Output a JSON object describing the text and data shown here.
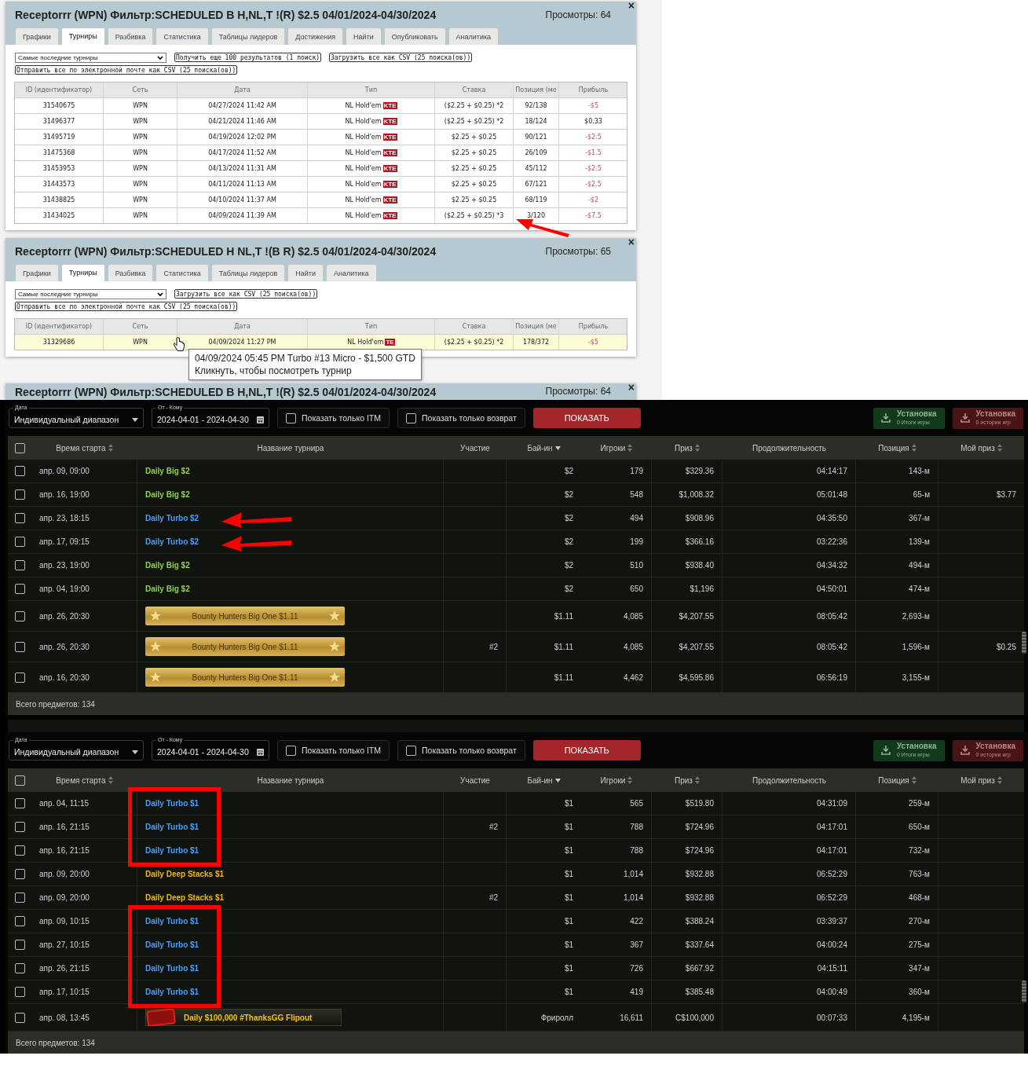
{
  "light_panels": [
    {
      "title": "Receptorrr (WPN) Фильтр:SCHEDULED B H,NL,T !(R) $2.5 04/01/2024-04/30/2024",
      "views": "Просмотры: 64",
      "close": "×",
      "tabs": [
        {
          "label": "Графики",
          "selected": false
        },
        {
          "label": "Турниры",
          "selected": true
        },
        {
          "label": "Разбивка",
          "selected": false
        },
        {
          "label": "Статистика",
          "selected": false
        },
        {
          "label": "Таблицы лидеров",
          "selected": false
        },
        {
          "label": "Достижения",
          "selected": false
        },
        {
          "label": "Найти",
          "selected": false
        },
        {
          "label": "Опубликовать",
          "selected": false
        },
        {
          "label": "Аналитика",
          "selected": false
        }
      ],
      "select": "Самые последние турниры",
      "actions": [
        "Получить еще 100 результатов (1 поиск)",
        "Загрузить все как CSV (25 поиска(ов))",
        "Отправить все по электронной почте как CSV (25 поиска(ов))"
      ],
      "columns": [
        "ID (идентификатор)",
        "Сеть",
        "Дата",
        "Тип",
        "Ставка",
        "Позиция (ме",
        "Прибыль"
      ],
      "rows": [
        {
          "id": "31540675",
          "network": "WPN",
          "date": "04/27/2024 11:42 AM",
          "type": "NL Hold'em",
          "badge": "KTE",
          "stake": "($2.25 + $0.25) *2",
          "position": "92/138",
          "profit": "-$5",
          "loss": true,
          "highlighted": false,
          "marked": false
        },
        {
          "id": "31496377",
          "network": "WPN",
          "date": "04/21/2024 11:46 AM",
          "type": "NL Hold'em",
          "badge": "KTE",
          "stake": "($2.25 + $0.25) *2",
          "position": "18/124",
          "profit": "$0.33",
          "loss": false,
          "highlighted": false,
          "marked": false
        },
        {
          "id": "31495719",
          "network": "WPN",
          "date": "04/19/2024 12:02 PM",
          "type": "NL Hold'em",
          "badge": "KTE",
          "stake": "$2.25 + $0.25",
          "position": "90/121",
          "profit": "-$2.5",
          "loss": true,
          "highlighted": false,
          "marked": false
        },
        {
          "id": "31475368",
          "network": "WPN",
          "date": "04/17/2024 11:52 AM",
          "type": "NL Hold'em",
          "badge": "KTE",
          "stake": "$2.25 + $0.25",
          "position": "26/109",
          "profit": "-$1.5",
          "loss": true,
          "highlighted": false,
          "marked": false
        },
        {
          "id": "31453953",
          "network": "WPN",
          "date": "04/13/2024 11:31 AM",
          "type": "NL Hold'em",
          "badge": "KTE",
          "stake": "$2.25 + $0.25",
          "position": "45/112",
          "profit": "-$2.5",
          "loss": true,
          "highlighted": false,
          "marked": false
        },
        {
          "id": "31443573",
          "network": "WPN",
          "date": "04/11/2024 11:13 AM",
          "type": "NL Hold'em",
          "badge": "KTE",
          "stake": "$2.25 + $0.25",
          "position": "67/121",
          "profit": "-$2.5",
          "loss": true,
          "highlighted": false,
          "marked": false
        },
        {
          "id": "31438825",
          "network": "WPN",
          "date": "04/10/2024 11:37 AM",
          "type": "NL Hold'em",
          "badge": "KTE",
          "stake": "$2.25 + $0.25",
          "position": "68/119",
          "profit": "-$2",
          "loss": true,
          "highlighted": false,
          "marked": false
        },
        {
          "id": "31434025",
          "network": "WPN",
          "date": "04/09/2024 11:39 AM",
          "type": "NL Hold'em",
          "badge": "KTE",
          "stake": "($2.25 + $0.25) *3",
          "position": "3/120",
          "profit": "-$7.5",
          "loss": true,
          "highlighted": false,
          "marked": true
        }
      ]
    },
    {
      "title": "Receptorrr (WPN) Фильтр:SCHEDULED H NL,T !(B R) $2.5 04/01/2024-04/30/2024",
      "views": "Просмотры: 65",
      "close": "×",
      "tabs": [
        {
          "label": "Графики",
          "selected": false
        },
        {
          "label": "Турниры",
          "selected": true
        },
        {
          "label": "Разбивка",
          "selected": false
        },
        {
          "label": "Статистика",
          "selected": false
        },
        {
          "label": "Таблицы лидеров",
          "selected": false
        },
        {
          "label": "Найти",
          "selected": false
        },
        {
          "label": "Аналитика",
          "selected": false
        }
      ],
      "select": "Самые последние турниры",
      "actions": [
        "Загрузить все как CSV (25 поиска(ов))",
        "Отправить все по электронной почте как CSV (25 поиска(ов))"
      ],
      "columns": [
        "ID (идентификатор)",
        "Сеть",
        "Дата",
        "Тип",
        "Ставка",
        "Позиция (ме",
        "Прибыль"
      ],
      "rows": [
        {
          "id": "31329686",
          "network": "WPN",
          "date": "04/09/2024 11:27 PM",
          "type": "NL Hold'em",
          "badge": "TE",
          "stake": "($2.25 + $0.25) *2",
          "position": "178/372",
          "profit": "-$5",
          "loss": true,
          "highlighted": true,
          "marked": false
        }
      ],
      "tooltip": [
        "04/09/2024 05:45 PM Turbo #13 Micro - $1,500 GTD",
        "Кликнуть, чтобы посмотреть турнир"
      ]
    }
  ],
  "partial_panel": {
    "title": "Receptorrr (WPN) Фильтр:SCHEDULED B H,NL,T !(R) $2.5 04/01/2024-04/30/2024",
    "views": "Просмотры: 64",
    "close": "×"
  },
  "dark_panels": [
    {
      "filters": {
        "date_label": "Дата",
        "date_value": "Индивидуальный диапазон",
        "range_label": "От - Кому",
        "range_value": "2024-04-01 - 2024-04-30",
        "checks": [
          {
            "label": "Показать только ITM",
            "checked": false
          },
          {
            "label": "Показать только возврат",
            "checked": false
          }
        ],
        "show": "ПОКАЗАТЬ",
        "exports": [
          {
            "title": "Установка",
            "sub": "0 Итоги игры",
            "kind": "green"
          },
          {
            "title": "Установка",
            "sub": "0 истории игр",
            "kind": "red"
          }
        ]
      },
      "header_checked": false,
      "columns": [
        {
          "label": "Время старта",
          "sortable": true,
          "sorted": false
        },
        {
          "label": "Название турнира",
          "sortable": false,
          "sorted": false
        },
        {
          "label": "Участие",
          "sortable": false,
          "sorted": false
        },
        {
          "label": "Бай-ин",
          "sortable": true,
          "sorted": true
        },
        {
          "label": "Игроки",
          "sortable": true,
          "sorted": false
        },
        {
          "label": "Приз",
          "sortable": true,
          "sorted": false
        },
        {
          "label": "Продолжительность",
          "sortable": false,
          "sorted": false
        },
        {
          "label": "Позиция",
          "sortable": true,
          "sorted": false
        },
        {
          "label": "Мой приз",
          "sortable": true,
          "sorted": false
        }
      ],
      "rows": [
        {
          "checked": false,
          "time": "апр. 09, 09:00",
          "name": "Daily Big $2",
          "kind": "text",
          "color": "#8fd14f",
          "entry": "",
          "buyin": "$2",
          "players": "179",
          "prize": "$329.36",
          "duration": "04:14:17",
          "position": "143-м",
          "my_prize": "",
          "marked": false,
          "framed": false
        },
        {
          "checked": false,
          "time": "апр. 16, 19:00",
          "name": "Daily Big $2",
          "kind": "text",
          "color": "#8fd14f",
          "entry": "",
          "buyin": "$2",
          "players": "548",
          "prize": "$1,008.32",
          "duration": "05:01:48",
          "position": "65-м",
          "my_prize": "$3.77",
          "marked": false,
          "framed": false
        },
        {
          "checked": false,
          "time": "апр. 23, 18:15",
          "name": "Daily Turbo $2",
          "kind": "text",
          "color": "#4f9cf2",
          "entry": "",
          "buyin": "$2",
          "players": "494",
          "prize": "$908.96",
          "duration": "04:35:50",
          "position": "367-м",
          "my_prize": "",
          "marked": true,
          "framed": false
        },
        {
          "checked": false,
          "time": "апр. 17, 09:15",
          "name": "Daily Turbo $2",
          "kind": "text",
          "color": "#4f9cf2",
          "entry": "",
          "buyin": "$2",
          "players": "199",
          "prize": "$366.16",
          "duration": "03:22:36",
          "position": "139-м",
          "my_prize": "",
          "marked": true,
          "framed": false
        },
        {
          "checked": false,
          "time": "апр. 23, 19:00",
          "name": "Daily Big $2",
          "kind": "text",
          "color": "#8fd14f",
          "entry": "",
          "buyin": "$2",
          "players": "510",
          "prize": "$938.40",
          "duration": "04:34:32",
          "position": "494-м",
          "my_prize": "",
          "marked": false,
          "framed": false
        },
        {
          "checked": false,
          "time": "апр. 04, 19:00",
          "name": "Daily Big $2",
          "kind": "text",
          "color": "#8fd14f",
          "entry": "",
          "buyin": "$2",
          "players": "650",
          "prize": "$1,196",
          "duration": "04:50:01",
          "position": "474-м",
          "my_prize": "",
          "marked": false,
          "framed": false
        },
        {
          "checked": false,
          "time": "апр. 26, 20:30",
          "name": "Bounty Hunters Big One $1.11",
          "kind": "banner",
          "entry": "",
          "buyin": "$1.11",
          "players": "4,085",
          "prize": "$4,207.55",
          "duration": "08:05:42",
          "position": "2,693-м",
          "my_prize": "",
          "marked": false,
          "framed": false
        },
        {
          "checked": false,
          "time": "апр. 26, 20:30",
          "name": "Bounty Hunters Big One $1.11",
          "kind": "banner",
          "entry": "#2",
          "buyin": "$1.11",
          "players": "4,085",
          "prize": "$4,207.55",
          "duration": "08:05:42",
          "position": "1,596-м",
          "my_prize": "$0.25",
          "marked": false,
          "framed": false
        },
        {
          "checked": false,
          "time": "апр. 16, 20:30",
          "name": "Bounty Hunters Big One $1.11",
          "kind": "banner",
          "entry": "",
          "buyin": "$1.11",
          "players": "4,462",
          "prize": "$4,595.86",
          "duration": "06:56:19",
          "position": "3,155-м",
          "my_prize": "",
          "marked": false,
          "framed": false
        }
      ],
      "footer": "Всего предметов: 134"
    },
    {
      "filters": {
        "date_label": "Дата",
        "date_value": "Индивидуальный диапазон",
        "range_label": "От - Кому",
        "range_value": "2024-04-01 - 2024-04-30",
        "checks": [
          {
            "label": "Показать только ITM",
            "checked": false
          },
          {
            "label": "Показать только возврат",
            "checked": false
          }
        ],
        "show": "ПОКАЗАТЬ",
        "exports": [
          {
            "title": "Установка",
            "sub": "0 Итоги игры",
            "kind": "green"
          },
          {
            "title": "Установка",
            "sub": "0 истории игр",
            "kind": "red"
          }
        ]
      },
      "header_checked": false,
      "columns": [
        {
          "label": "Время старта",
          "sortable": true,
          "sorted": false
        },
        {
          "label": "Название турнира",
          "sortable": false,
          "sorted": false
        },
        {
          "label": "Участие",
          "sortable": false,
          "sorted": false
        },
        {
          "label": "Бай-ин",
          "sortable": true,
          "sorted": true
        },
        {
          "label": "Игроки",
          "sortable": true,
          "sorted": false
        },
        {
          "label": "Приз",
          "sortable": true,
          "sorted": false
        },
        {
          "label": "Продолжительность",
          "sortable": false,
          "sorted": false
        },
        {
          "label": "Позиция",
          "sortable": true,
          "sorted": false
        },
        {
          "label": "Мой приз",
          "sortable": true,
          "sorted": false
        }
      ],
      "rows": [
        {
          "checked": false,
          "time": "апр. 04, 11:15",
          "name": "Daily Turbo $1",
          "kind": "text",
          "color": "#4f9cf2",
          "entry": "",
          "buyin": "$1",
          "players": "565",
          "prize": "$519.80",
          "duration": "04:31:09",
          "position": "259-м",
          "my_prize": "",
          "marked": false,
          "framed": true
        },
        {
          "checked": false,
          "time": "апр. 16, 21:15",
          "name": "Daily Turbo $1",
          "kind": "text",
          "color": "#4f9cf2",
          "entry": "#2",
          "buyin": "$1",
          "players": "788",
          "prize": "$724.96",
          "duration": "04:17:01",
          "position": "650-м",
          "my_prize": "",
          "marked": false,
          "framed": true
        },
        {
          "checked": false,
          "time": "апр. 16, 21:15",
          "name": "Daily Turbo $1",
          "kind": "text",
          "color": "#4f9cf2",
          "entry": "",
          "buyin": "$1",
          "players": "788",
          "prize": "$724.96",
          "duration": "04:17:01",
          "position": "732-м",
          "my_prize": "",
          "marked": false,
          "framed": true
        },
        {
          "checked": false,
          "time": "апр. 09, 20:00",
          "name": "Daily Deep Stacks $1",
          "kind": "text",
          "color": "#f2b705",
          "entry": "",
          "buyin": "$1",
          "players": "1,014",
          "prize": "$932.88",
          "duration": "06:52:29",
          "position": "763-м",
          "my_prize": "",
          "marked": false,
          "framed": false
        },
        {
          "checked": false,
          "time": "апр. 09, 20:00",
          "name": "Daily Deep Stacks $1",
          "kind": "text",
          "color": "#f2b705",
          "entry": "#2",
          "buyin": "$1",
          "players": "1,014",
          "prize": "$932.88",
          "duration": "06:52:29",
          "position": "468-м",
          "my_prize": "",
          "marked": false,
          "framed": false
        },
        {
          "checked": false,
          "time": "апр. 09, 10:15",
          "name": "Daily Turbo $1",
          "kind": "text",
          "color": "#4f9cf2",
          "entry": "",
          "buyin": "$1",
          "players": "422",
          "prize": "$388.24",
          "duration": "03:39:37",
          "position": "270-м",
          "my_prize": "",
          "marked": false,
          "framed": true
        },
        {
          "checked": false,
          "time": "апр. 27, 10:15",
          "name": "Daily Turbo $1",
          "kind": "text",
          "color": "#4f9cf2",
          "entry": "",
          "buyin": "$1",
          "players": "367",
          "prize": "$337.64",
          "duration": "04:00:24",
          "position": "275-м",
          "my_prize": "",
          "marked": false,
          "framed": true
        },
        {
          "checked": false,
          "time": "апр. 26, 21:15",
          "name": "Daily Turbo $1",
          "kind": "text",
          "color": "#4f9cf2",
          "entry": "",
          "buyin": "$1",
          "players": "726",
          "prize": "$667.92",
          "duration": "04:15:11",
          "position": "347-м",
          "my_prize": "",
          "marked": false,
          "framed": true
        },
        {
          "checked": false,
          "time": "апр. 17, 10:15",
          "name": "Daily Turbo $1",
          "kind": "text",
          "color": "#4f9cf2",
          "entry": "",
          "buyin": "$1",
          "players": "419",
          "prize": "$385.48",
          "duration": "04:00:49",
          "position": "360-м",
          "my_prize": "",
          "marked": false,
          "framed": true
        },
        {
          "checked": false,
          "time": "апр. 08, 13:45",
          "name": "Daily $100,000 #ThanksGG Flipout",
          "kind": "logo_banner",
          "entry": "",
          "buyin": "Фриролл",
          "players": "16,611",
          "prize": "C$100,000",
          "duration": "00:07:33",
          "position": "4,195-м",
          "my_prize": "",
          "marked": false,
          "framed": false
        }
      ],
      "footer": "Всего предметов: 134"
    }
  ]
}
